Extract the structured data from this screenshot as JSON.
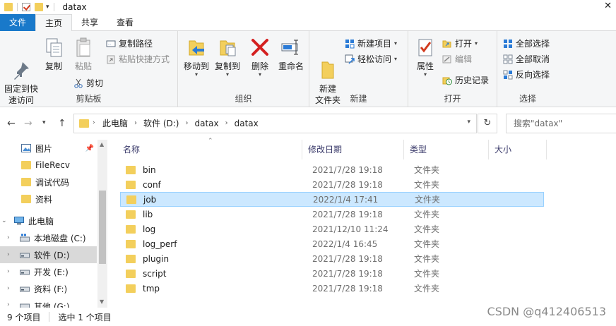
{
  "window": {
    "title": "datax",
    "close_glyph": "✕"
  },
  "tabs": [
    {
      "label": "文件"
    },
    {
      "label": "主页"
    },
    {
      "label": "共享"
    },
    {
      "label": "查看"
    }
  ],
  "ribbon": {
    "clipboard": {
      "label": "剪贴板",
      "pin_label": "固定到快\n速访问",
      "copy_label": "复制",
      "paste_label": "粘贴",
      "copy_path_label": "复制路径",
      "paste_shortcut_label": "粘贴快捷方式",
      "cut_label": "剪切"
    },
    "organize": {
      "label": "组织",
      "move_to_label": "移动到",
      "copy_to_label": "复制到",
      "delete_label": "删除",
      "rename_label": "重命名"
    },
    "new": {
      "label": "新建",
      "new_folder_label": "新建\n文件夹",
      "new_item_label": "新建项目",
      "easy_access_label": "轻松访问"
    },
    "open": {
      "label": "打开",
      "properties_label": "属性",
      "open_label": "打开",
      "edit_label": "编辑",
      "history_label": "历史记录"
    },
    "select": {
      "label": "选择",
      "select_all_label": "全部选择",
      "select_none_label": "全部取消",
      "invert_label": "反向选择"
    }
  },
  "address": {
    "crumbs": [
      "此电脑",
      "软件 (D:)",
      "datax",
      "datax"
    ],
    "search_placeholder": "搜索\"datax\""
  },
  "navpane": {
    "items": [
      {
        "label": "图片",
        "icon": "pictures-icon",
        "pinned": true
      },
      {
        "label": "FileRecv",
        "icon": "folder-icon"
      },
      {
        "label": "调试代码",
        "icon": "folder-icon"
      },
      {
        "label": "资料",
        "icon": "folder-icon"
      },
      {
        "label": "此电脑",
        "icon": "computer-icon"
      },
      {
        "label": "本地磁盘 (C:)",
        "icon": "drive-c-icon"
      },
      {
        "label": "软件 (D:)",
        "icon": "drive-icon"
      },
      {
        "label": "开发 (E:)",
        "icon": "drive-icon"
      },
      {
        "label": "资料 (F:)",
        "icon": "drive-icon"
      },
      {
        "label": "其他 (G:)",
        "icon": "drive-icon"
      }
    ]
  },
  "filelist": {
    "columns": [
      "名称",
      "修改日期",
      "类型",
      "大小"
    ],
    "rows": [
      {
        "name": "bin",
        "date": "2021/7/28 19:18",
        "type": "文件夹"
      },
      {
        "name": "conf",
        "date": "2021/7/28 19:18",
        "type": "文件夹"
      },
      {
        "name": "job",
        "date": "2022/1/4 17:41",
        "type": "文件夹"
      },
      {
        "name": "lib",
        "date": "2021/7/28 19:18",
        "type": "文件夹"
      },
      {
        "name": "log",
        "date": "2021/12/10 11:24",
        "type": "文件夹"
      },
      {
        "name": "log_perf",
        "date": "2022/1/4 16:45",
        "type": "文件夹"
      },
      {
        "name": "plugin",
        "date": "2021/7/28 19:18",
        "type": "文件夹"
      },
      {
        "name": "script",
        "date": "2021/7/28 19:18",
        "type": "文件夹"
      },
      {
        "name": "tmp",
        "date": "2021/7/28 19:18",
        "type": "文件夹"
      }
    ]
  },
  "status": {
    "count": "9 个项目",
    "selected": "选中 1 个项目"
  },
  "watermark": "CSDN @q412406513",
  "colors": {
    "accent": "#1979ca",
    "folder": "#f3cf5c",
    "selection": "#cce8ff"
  }
}
